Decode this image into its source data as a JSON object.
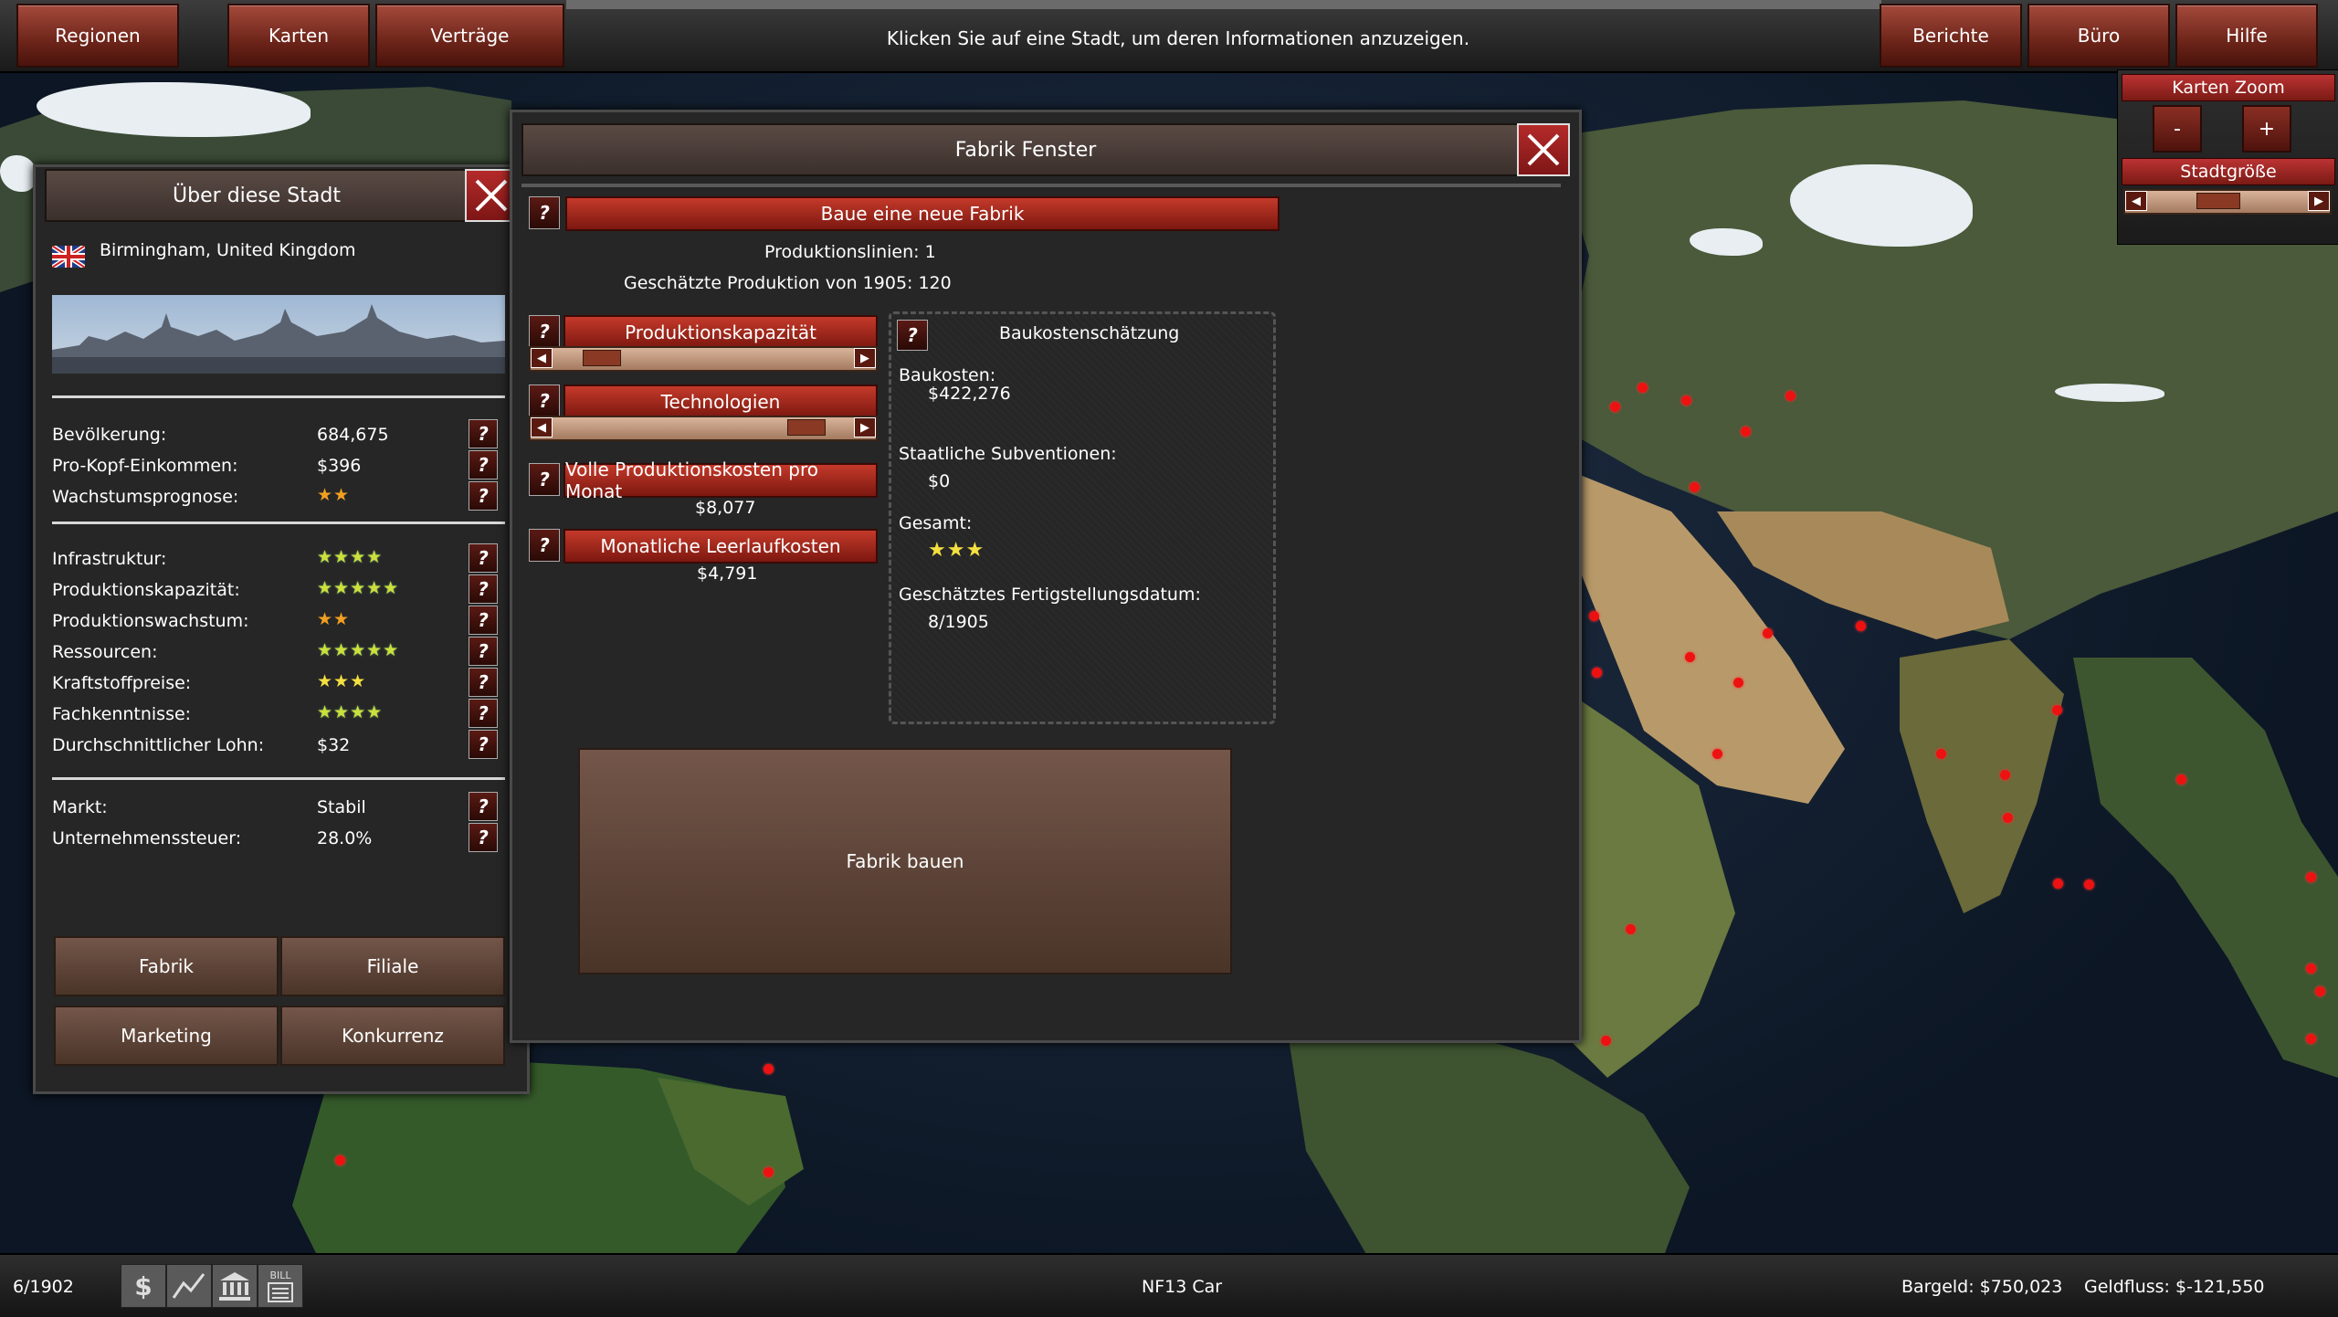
{
  "top_nav": {
    "left_buttons": [
      "Regionen",
      "Karten",
      "Verträge"
    ],
    "right_buttons": [
      "Berichte",
      "Büro",
      "Hilfe"
    ],
    "hint": "Klicken Sie auf eine Stadt, um deren Informationen anzuzeigen."
  },
  "zoom_panel": {
    "zoom_label": "Karten Zoom",
    "minus": "-",
    "plus": "+",
    "citysize_label": "Stadtgröße"
  },
  "city_panel": {
    "title": "Über diese Stadt",
    "location": "Birmingham, United Kingdom",
    "stats_a": [
      {
        "label": "Bevölkerung:",
        "value": "684,675"
      },
      {
        "label": "Pro-Kopf-Einkommen:",
        "value": "$396"
      },
      {
        "label": "Wachstumsprognose:",
        "stars": "★★",
        "star_color": "orange"
      }
    ],
    "stats_b": [
      {
        "label": "Infrastruktur:",
        "stars": "★★★★",
        "star_color": "green"
      },
      {
        "label": "Produktionskapazität:",
        "stars": "★★★★★",
        "star_color": "green"
      },
      {
        "label": "Produktionswachstum:",
        "stars": "★★",
        "star_color": "orange"
      },
      {
        "label": "Ressourcen:",
        "stars": "★★★★★",
        "star_color": "green"
      },
      {
        "label": "Kraftstoffpreise:",
        "stars": "★★★",
        "star_color": "gold"
      },
      {
        "label": "Fachkenntnisse:",
        "stars": "★★★★",
        "star_color": "green"
      },
      {
        "label": "Durchschnittlicher Lohn:",
        "value": "$32"
      }
    ],
    "stats_c": [
      {
        "label": "Markt:",
        "value": "Stabil"
      },
      {
        "label": "Unternehmenssteuer:",
        "value": "28.0%"
      }
    ],
    "buttons": [
      "Fabrik",
      "Filiale",
      "Marketing",
      "Konkurrenz"
    ],
    "help_glyph": "?"
  },
  "factory_panel": {
    "title": "Fabrik Fenster",
    "build_new": "Baue eine neue Fabrik",
    "production_lines": "Produktionslinien: 1",
    "estimated_production": "Geschätzte Produktion von 1905: 120",
    "capacity_label": "Produktionskapazität",
    "capacity_level": 0.12,
    "tech_label": "Technologien",
    "tech_level": 0.88,
    "full_cost_label": "Volle Produktionskosten pro Monat",
    "full_cost_value": "$8,077",
    "idle_cost_label": "Monatliche Leerlaufkosten",
    "idle_cost_value": "$4,791",
    "estimate": {
      "title": "Baukostenschätzung",
      "construction_cost_label": "Baukosten:",
      "construction_cost_value": "$422,276",
      "subsidies_label": "Staatliche Subventionen:",
      "subsidies_value": "$0",
      "total_label": "Gesamt:",
      "total_stars": "★★★",
      "completion_label": "Geschätztes Fertigstellungsdatum:",
      "completion_value": "8/1905"
    },
    "build_button": "Fabrik bauen"
  },
  "bottom_bar": {
    "date": "6/1902",
    "product": "NF13 Car",
    "cash": "Bargeld: $750,023",
    "cashflow": "Geldfluss: $-121,550",
    "tool_icons": [
      "dollar-icon",
      "trend-chart-icon",
      "bank-icon",
      "bill-icon"
    ],
    "bill_glyph": "BILL"
  },
  "colors": {
    "accent_red": "#8a2a1e",
    "panel_bg": "#262626",
    "city_dot": "#ee1111"
  }
}
